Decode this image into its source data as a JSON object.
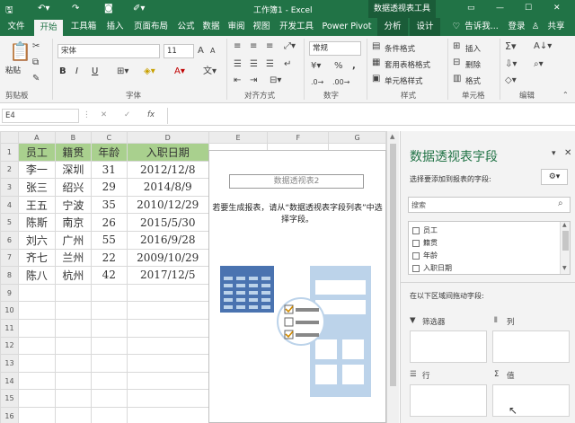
{
  "titlebar": {
    "title": "工作簿1 - Excel",
    "tool_tab": "数据透视表工具"
  },
  "tabs": [
    "文件",
    "开始",
    "工具箱",
    "插入",
    "页面布局",
    "公式",
    "数据",
    "审阅",
    "视图",
    "开发工具",
    "Power Pivot",
    "分析",
    "设计"
  ],
  "tell_me": "告诉我...",
  "login": "登录",
  "share": "共享",
  "ribbon": {
    "paste": "粘贴",
    "clipboard": "剪贴板",
    "font_name": "宋体",
    "font_size": "11",
    "bold": "B",
    "italic": "I",
    "underline": "U",
    "font_group": "字体",
    "align_group": "对齐方式",
    "number_format": "常规",
    "number_group": "数字",
    "cond_format": "条件格式",
    "table_format": "套用表格格式",
    "cell_style": "单元格样式",
    "style_group": "样式",
    "insert": "插入",
    "delete": "删除",
    "format": "格式",
    "cells_group": "单元格",
    "edit_group": "编辑"
  },
  "formula_bar": {
    "name_box": "E4",
    "fx": "fx",
    "cancel": "✕",
    "enter": "✓"
  },
  "columns": [
    "A",
    "B",
    "C",
    "D",
    "E",
    "F",
    "G"
  ],
  "rows": [
    "1",
    "2",
    "3",
    "4",
    "5",
    "6",
    "7",
    "8",
    "9",
    "10",
    "11",
    "12",
    "13",
    "14",
    "15",
    "16"
  ],
  "table": {
    "headers": [
      "员工",
      "籍贯",
      "年龄",
      "入职日期"
    ],
    "data": [
      [
        "李一",
        "深圳",
        "31",
        "2012/12/8"
      ],
      [
        "张三",
        "绍兴",
        "29",
        "2014/8/9"
      ],
      [
        "王五",
        "宁波",
        "35",
        "2010/12/29"
      ],
      [
        "陈斯",
        "南京",
        "26",
        "2015/5/30"
      ],
      [
        "刘六",
        "广州",
        "55",
        "2016/9/28"
      ],
      [
        "齐七",
        "兰州",
        "22",
        "2009/10/29"
      ],
      [
        "陈八",
        "杭州",
        "42",
        "2017/12/5"
      ]
    ]
  },
  "pivot": {
    "title": "数据透视表2",
    "hint": "若要生成报表，请从“数据透视表字段列表”中选择字段。"
  },
  "panel": {
    "title": "数据透视表字段",
    "subtitle": "选择要添加到报表的字段:",
    "search": "搜索",
    "fields": [
      "员工",
      "籍贯",
      "年龄",
      "入职日期"
    ],
    "drag_hint": "在以下区域间拖动字段:",
    "filters": "筛选器",
    "columns": "列",
    "rows": "行",
    "values": "值",
    "filter_icon": "funnel-icon",
    "sigma": "Σ"
  },
  "colors": {
    "excel_green": "#217346",
    "header_fill": "#a9d08e",
    "pivot_blue": "#4a73b0",
    "pivot_light": "#bcd3ea"
  }
}
